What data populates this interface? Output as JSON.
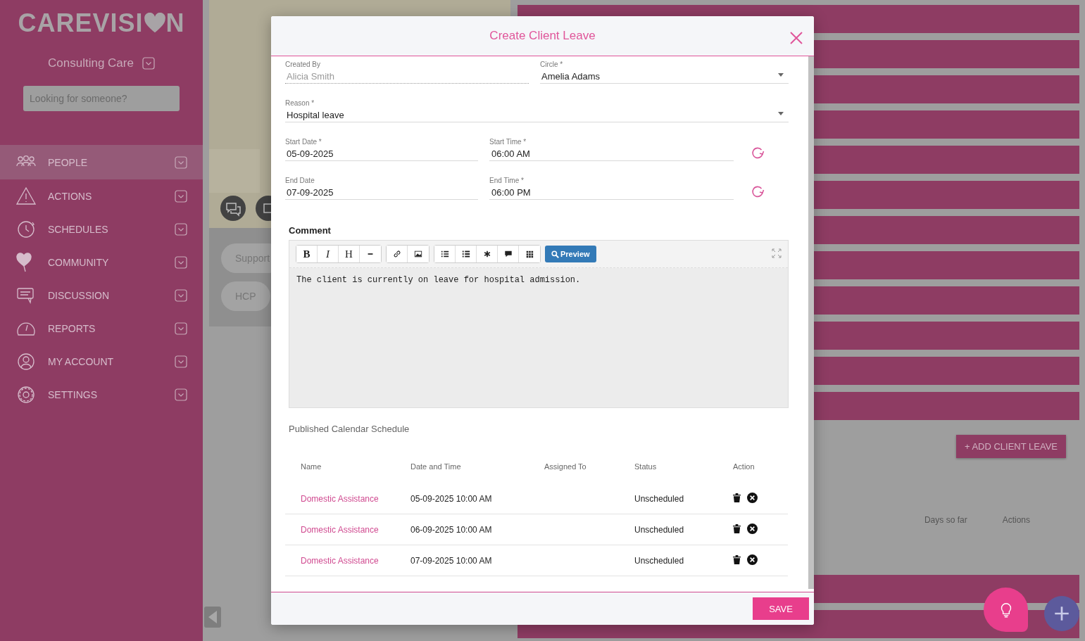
{
  "sidebar": {
    "logo": {
      "before": "CAREVISI",
      "after": "N"
    },
    "organization": "Consulting Care",
    "search": {
      "placeholder": "Looking for someone?"
    },
    "items": [
      {
        "label": "PEOPLE",
        "kind": "people",
        "selected": true
      },
      {
        "label": "ACTIONS",
        "kind": "warning",
        "selected": false
      },
      {
        "label": "SCHEDULES",
        "kind": "clock",
        "selected": false
      },
      {
        "label": "COMMUNITY",
        "kind": "heart",
        "selected": false
      },
      {
        "label": "DISCUSSION",
        "kind": "chat",
        "selected": false
      },
      {
        "label": "REPORTS",
        "kind": "gauge",
        "selected": false
      },
      {
        "label": "MY ACCOUNT",
        "kind": "user",
        "selected": false
      },
      {
        "label": "SETTINGS",
        "kind": "gear",
        "selected": false
      }
    ]
  },
  "background": {
    "pills": [
      "Support",
      "HCP"
    ],
    "add_button": "+ ADD CLIENT LEAVE",
    "columns": [
      "Days so far",
      "Actions"
    ]
  },
  "modal": {
    "title": "Create Client Leave",
    "created_by": {
      "label": "Created By",
      "value": "Alicia Smith",
      "disabled": true
    },
    "circle": {
      "label": "Circle *",
      "value": "Amelia Adams"
    },
    "reason": {
      "label": "Reason *",
      "value": "Hospital leave"
    },
    "start_date": {
      "label": "Start Date *",
      "value": "05-09-2025"
    },
    "start_time": {
      "label": "Start Time *",
      "value": "06:00 AM"
    },
    "end_date": {
      "label": "End Date",
      "value": "07-09-2025"
    },
    "end_time": {
      "label": "End Time *",
      "value": "06:00 PM"
    },
    "comment_label": "Comment",
    "toolbar": [
      [
        {
          "kind": "bold",
          "text": "B"
        },
        {
          "kind": "italic",
          "text": "I"
        },
        {
          "kind": "heading",
          "text": "H"
        },
        {
          "kind": "rule"
        }
      ],
      [
        {
          "kind": "link"
        },
        {
          "kind": "image"
        }
      ],
      [
        {
          "kind": "ordered"
        },
        {
          "kind": "unordered"
        },
        {
          "kind": "asterisk"
        },
        {
          "kind": "comment"
        },
        {
          "kind": "table"
        }
      ]
    ],
    "preview": "Preview",
    "comment": "The client is currently on leave for hospital admission.",
    "schedule_title": "Published Calendar Schedule",
    "columns": [
      "Name",
      "Date and Time",
      "Assigned To",
      "Status",
      "Action"
    ],
    "rows": [
      {
        "name": "Domestic Assistance",
        "datetime": "05-09-2025 10:00 AM",
        "status": "Unscheduled"
      },
      {
        "name": "Domestic Assistance",
        "datetime": "06-09-2025 10:00 AM",
        "status": "Unscheduled"
      },
      {
        "name": "Domestic Assistance",
        "datetime": "07-09-2025 10:00 AM",
        "status": "Unscheduled"
      }
    ],
    "save": "SAVE"
  }
}
